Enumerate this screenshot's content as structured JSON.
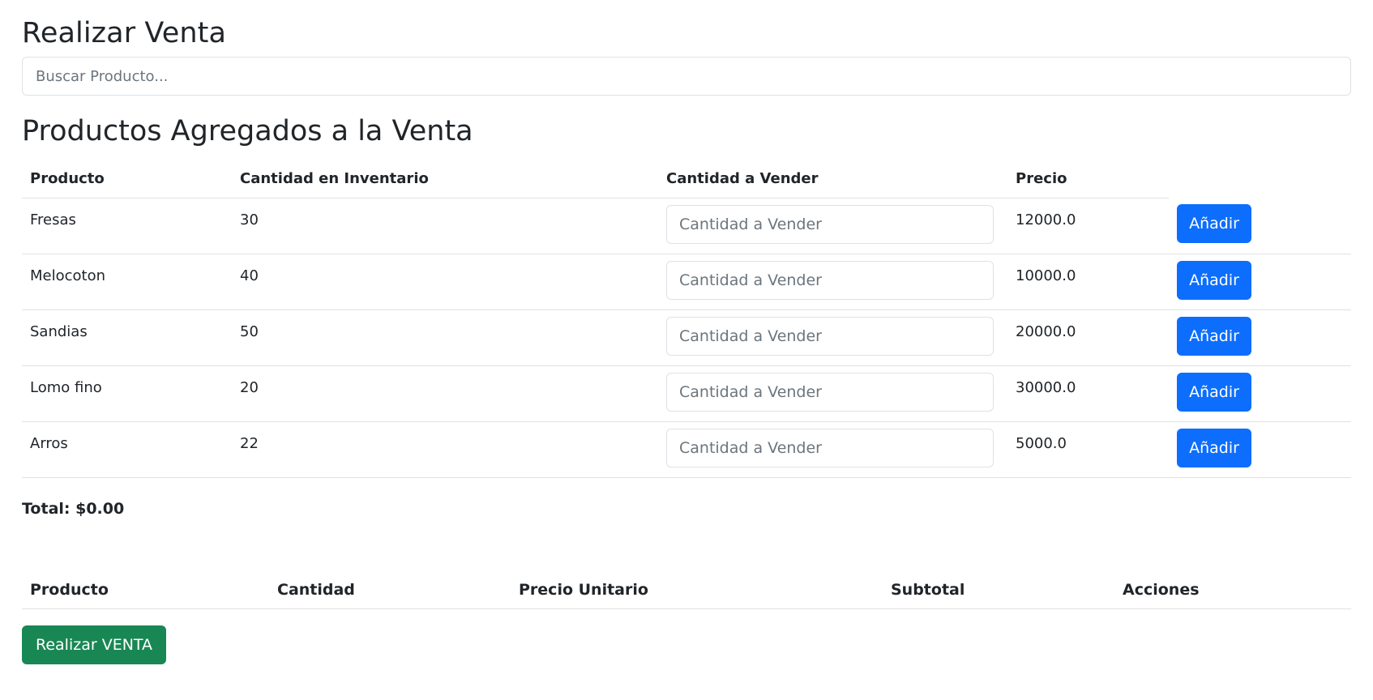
{
  "page": {
    "title": "Realizar Venta",
    "search_placeholder": "Buscar Producto...",
    "added_title": "Productos Agregados a la Venta"
  },
  "products_table": {
    "headers": [
      "Producto",
      "Cantidad en Inventario",
      "Cantidad a Vender",
      "Precio"
    ],
    "quantity_placeholder": "Cantidad a Vender",
    "add_label": "Añadir",
    "rows": [
      {
        "name": "Fresas",
        "stock": "30",
        "price": "12000.0"
      },
      {
        "name": "Melocoton",
        "stock": "40",
        "price": "10000.0"
      },
      {
        "name": "Sandias",
        "stock": "50",
        "price": "20000.0"
      },
      {
        "name": "Lomo fino",
        "stock": "20",
        "price": "30000.0"
      },
      {
        "name": "Arros",
        "stock": "22",
        "price": "5000.0"
      }
    ]
  },
  "total": "Total: $0.00",
  "sale_table": {
    "headers": [
      "Producto",
      "Cantidad",
      "Precio Unitario",
      "Subtotal",
      "Acciones"
    ]
  },
  "submit_label": "Realizar VENTA",
  "colors": {
    "primary": "#0d6efd",
    "success": "#198754",
    "border": "#dee2e6",
    "text": "#212529",
    "placeholder": "#6c757d"
  }
}
